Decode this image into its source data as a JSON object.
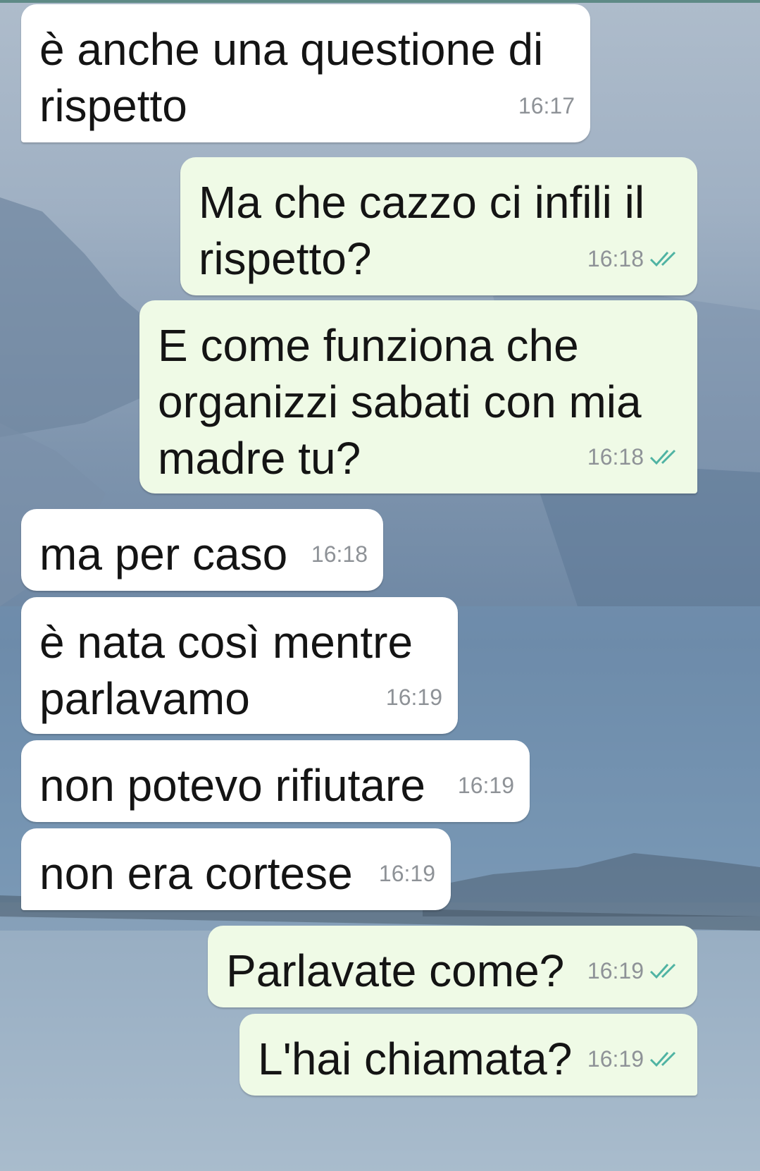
{
  "colors": {
    "incoming_bubble": "#ffffff",
    "outgoing_bubble": "#effae6",
    "timestamp": "#8e9297",
    "read_ticks": "#4fb3a3"
  },
  "messages": [
    {
      "direction": "in",
      "text": "è anche una questione di\nrispetto",
      "time": "16:17",
      "ticks": ""
    },
    {
      "direction": "out",
      "text": "Ma che cazzo ci infili il\nrispetto?",
      "time": "16:18",
      "ticks": "double-check-icon"
    },
    {
      "direction": "out",
      "text": "E come funziona che\norganizzi sabati con mia\nmadre tu?",
      "time": "16:18",
      "ticks": "double-check-icon"
    },
    {
      "direction": "in",
      "text": "ma per caso",
      "time": "16:18",
      "ticks": ""
    },
    {
      "direction": "in",
      "text": "è nata così mentre\nparlavamo",
      "time": "16:19",
      "ticks": ""
    },
    {
      "direction": "in",
      "text": "non potevo rifiutare",
      "time": "16:19",
      "ticks": ""
    },
    {
      "direction": "in",
      "text": "non era cortese",
      "time": "16:19",
      "ticks": ""
    },
    {
      "direction": "out",
      "text": "Parlavate come?",
      "time": "16:19",
      "ticks": "double-check-icon"
    },
    {
      "direction": "out",
      "text": "L'hai chiamata?",
      "time": "16:19",
      "ticks": "double-check-icon"
    }
  ]
}
